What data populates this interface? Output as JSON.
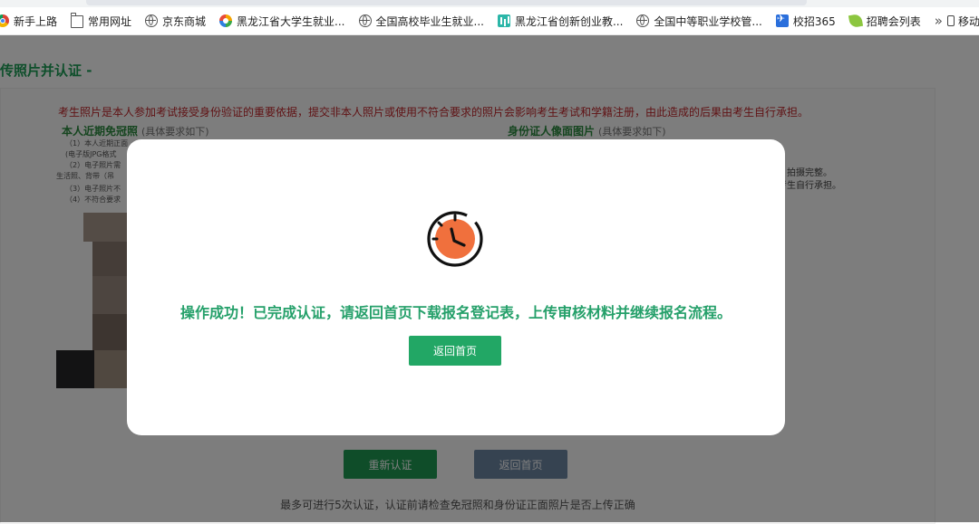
{
  "bookmarks": {
    "items": [
      {
        "label": "新手上路",
        "icon": "chrome-icon"
      },
      {
        "label": "常用网址",
        "icon": "folder-icon"
      },
      {
        "label": "京东商城",
        "icon": "globe-icon"
      },
      {
        "label": "黑龙江省大学生就业...",
        "icon": "swirl-icon"
      },
      {
        "label": "全国高校毕业生就业...",
        "icon": "globe-icon"
      },
      {
        "label": "黑龙江省创新创业教...",
        "icon": "teal-icon"
      },
      {
        "label": "全国中等职业学校管...",
        "icon": "globe-icon"
      },
      {
        "label": "校招365",
        "icon": "blue-icon"
      },
      {
        "label": "招聘会列表",
        "icon": "leaf-icon"
      }
    ],
    "more": "»",
    "mobile_label": "移动设备上"
  },
  "page": {
    "title": "传照片并认证 -",
    "warning": "考生照片是本人参加考试接受身份验证的重要依据，提交非本人照片或使用不符合要求的照片会影响考生考试和学籍注册，由此造成的后果由考生自行承担。",
    "photo_section": {
      "title": "本人近期免冠照",
      "hint": "(具体要求如下)"
    },
    "id_section": {
      "title": "身份证人像面图片",
      "hint": "(具体要求如下)"
    },
    "requirements_left": [
      "（1）本人近期正面",
      "(电子版JPG格式",
      "（2）电子照片需",
      "生活照、背带（吊",
      "（3）电子照片不",
      "（4）不符合要求"
    ],
    "requirements_right": [
      "拍摄完整。",
      "考生自行承担。"
    ],
    "retry_button": "重新认证",
    "home_button": "返回首页",
    "bottom_tip": "最多可进行5次认证，认证前请检查免冠照和身份证正面照片是否上传正确"
  },
  "modal": {
    "icon": "clock-icon",
    "message": "操作成功！已完成认证，请返回首页下载报名登记表，上传审核材料并继续报名流程。",
    "button": "返回首页"
  },
  "colors": {
    "accent_green": "#22a765",
    "message_green": "#25a06a",
    "warning_red": "#c0262b",
    "clock_orange": "#f0703d"
  }
}
